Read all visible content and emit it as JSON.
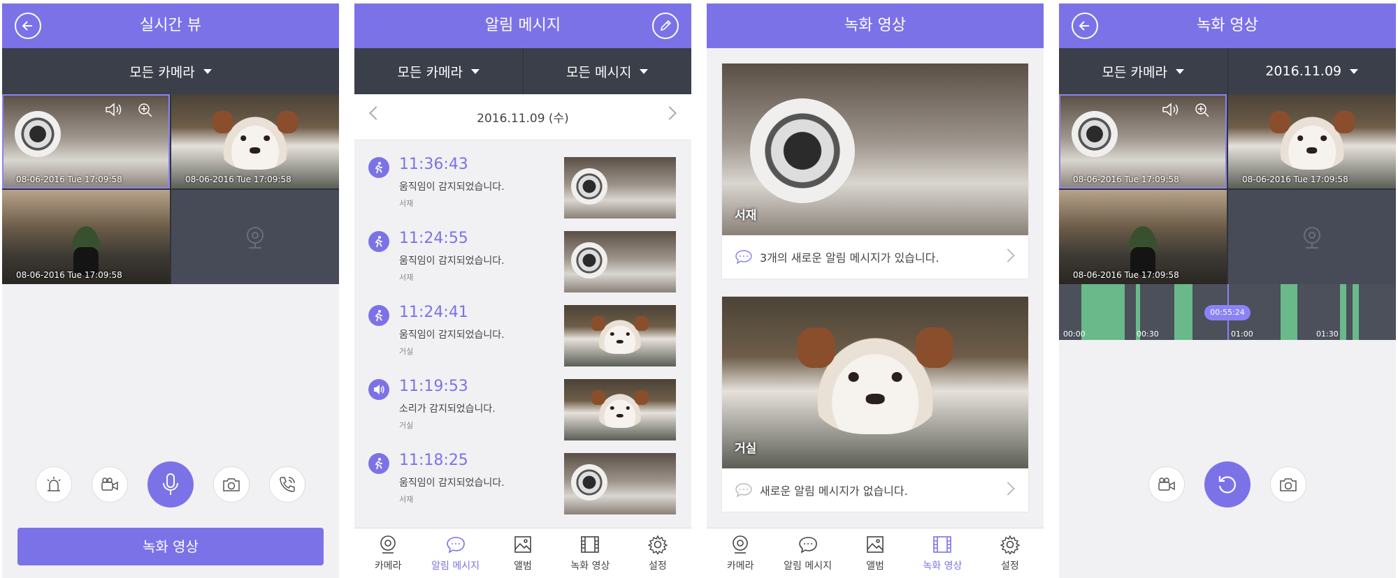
{
  "live": {
    "title": "실시간 뷰",
    "filter": "모든 카메라",
    "timestamps": [
      "08-06-2016 Tue 17:09:58",
      "08-06-2016 Tue 17:09:58",
      "08-06-2016 Tue 17:09:58"
    ],
    "record_button": "녹화 영상",
    "controls": [
      "siren-icon",
      "video-icon",
      "mic-icon",
      "camera-icon",
      "phone-icon"
    ]
  },
  "alerts": {
    "title": "알림 메시지",
    "filter_camera": "모든 카메라",
    "filter_message": "모든 메시지",
    "date": "2016.11.09 (수)",
    "items": [
      {
        "time": "11:36:43",
        "message": "움직임이 감지되었습니다.",
        "camera": "서재",
        "type": "motion",
        "scene": "speaker"
      },
      {
        "time": "11:24:55",
        "message": "움직임이 감지되었습니다.",
        "camera": "서재",
        "type": "motion",
        "scene": "speaker"
      },
      {
        "time": "11:24:41",
        "message": "움직임이 감지되었습니다.",
        "camera": "거실",
        "type": "motion",
        "scene": "dog"
      },
      {
        "time": "11:19:53",
        "message": "소리가 감지되었습니다.",
        "camera": "거실",
        "type": "sound",
        "scene": "dog"
      },
      {
        "time": "11:18:25",
        "message": "움직임이 감지되었습니다.",
        "camera": "서재",
        "type": "motion",
        "scene": "speaker"
      }
    ]
  },
  "recordings": {
    "title": "녹화 영상",
    "cards": [
      {
        "camera": "서재",
        "info": "3개의 새로운 알림 메시지가 있습니다."
      },
      {
        "camera": "거실",
        "info": "새로운 알림 메시지가 없습니다."
      }
    ]
  },
  "playback": {
    "title": "녹화 영상",
    "filter": "모든 카메라",
    "date": "2016.11.09",
    "timestamps": [
      "08-06-2016 Tue 17:09:58",
      "08-06-2016 Tue 17:09:58",
      "08-06-2016 Tue 17:09:58"
    ],
    "timeline_ticks": [
      "00:00",
      "00:30",
      "01:00",
      "01:30"
    ],
    "current_time": "00:55:24"
  },
  "tabbar": {
    "tabs": [
      "카메라",
      "알림 메시지",
      "앨범",
      "녹화 영상",
      "설정"
    ]
  },
  "colors": {
    "accent": "#7c72e8",
    "dark_bar": "#3b3f4a",
    "timeline_green": "#69b98a"
  }
}
